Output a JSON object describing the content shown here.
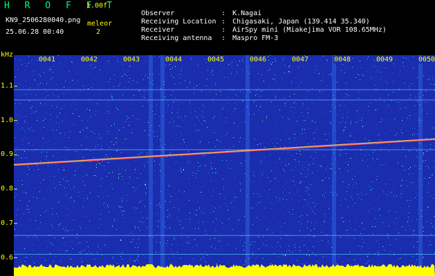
{
  "header": {
    "title": "H R O F F T",
    "version": "1.00f",
    "filename": "KN9_2506280040.png",
    "datetime": "25.06.28 00:40",
    "meleor_label": "meleor",
    "meleor_count": "2"
  },
  "meta": [
    {
      "label": "Observer",
      "value": "K.Nagai"
    },
    {
      "label": "Receiving Location",
      "value": "Chigasaki, Japan (139.414 35.340)"
    },
    {
      "label": "Receiver",
      "value": "AirSpy mini (Miakejima VOR 108.65MHz)"
    },
    {
      "label": "Receiving antenna",
      "value": "Maspro FM-3"
    }
  ],
  "chart_data": {
    "type": "heatmap",
    "ylabel": "kHz",
    "yticks": [
      "1.1",
      "1.0",
      "0.9",
      "0.8",
      "0.7",
      "0.6"
    ],
    "xticks": [
      "0041",
      "0042",
      "0043",
      "0044",
      "0045",
      "0046",
      "0047",
      "0048",
      "0049",
      "0050"
    ],
    "ylim": [
      0.58,
      1.2
    ],
    "signal_trace": {
      "start_khz": 0.87,
      "end_khz": 0.945
    },
    "colors": {
      "background": "#1a2dae",
      "noise": "#33cfff",
      "trace": "#ff4040",
      "baseline": "#ffff00"
    }
  }
}
